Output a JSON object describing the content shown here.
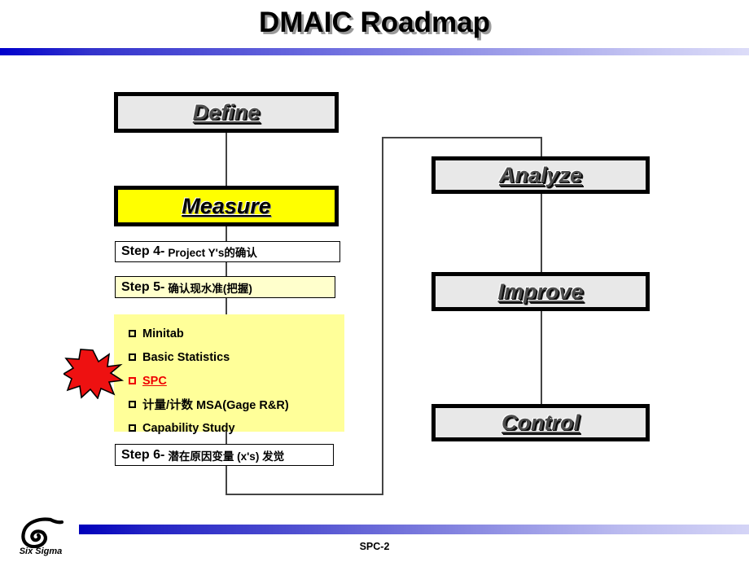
{
  "slide": {
    "title": "DMAIC Roadmap",
    "page_label": "SPC-2",
    "accent_color": "#0000cc",
    "highlight_color": "#ffff00",
    "alert_color": "#ee0000"
  },
  "logo": {
    "text": "Six Sigma",
    "glyph_name": "six-sigma-spiral-logo"
  },
  "phases": [
    {
      "id": "define",
      "label": "Define",
      "state": "normal",
      "fill": "#e8e8e8"
    },
    {
      "id": "measure",
      "label": "Measure",
      "state": "highlight",
      "fill": "#ffff00"
    },
    {
      "id": "analyze",
      "label": "Analyze",
      "state": "normal",
      "fill": "#e8e8e8"
    },
    {
      "id": "improve",
      "label": "Improve",
      "state": "normal",
      "fill": "#e8e8e8"
    },
    {
      "id": "control",
      "label": "Control",
      "state": "normal",
      "fill": "#e8e8e8"
    }
  ],
  "steps": [
    {
      "id": "step4",
      "number": "Step 4-",
      "text": "Project Y's的确认",
      "fill": "#ffffff"
    },
    {
      "id": "step5",
      "number": "Step 5-",
      "text": "确认现水准(把握)",
      "fill": "#ffffcc"
    },
    {
      "id": "step6",
      "number": "Step 6-",
      "text": "潜在原因变量 (x's) 发觉",
      "fill": "#ffffff"
    }
  ],
  "topics": {
    "panel_fill": "#ffff99",
    "items": [
      {
        "label": "Minitab",
        "emphasis": "none"
      },
      {
        "label": "Basic Statistics",
        "emphasis": "none"
      },
      {
        "label": "SPC",
        "emphasis": "red"
      },
      {
        "label": "计量/计数 MSA(Gage R&R)",
        "emphasis": "none"
      },
      {
        "label": "Capability Study",
        "emphasis": "none"
      }
    ]
  },
  "callout": {
    "name": "starburst-pointer",
    "target": "SPC",
    "color": "#ee1111"
  }
}
